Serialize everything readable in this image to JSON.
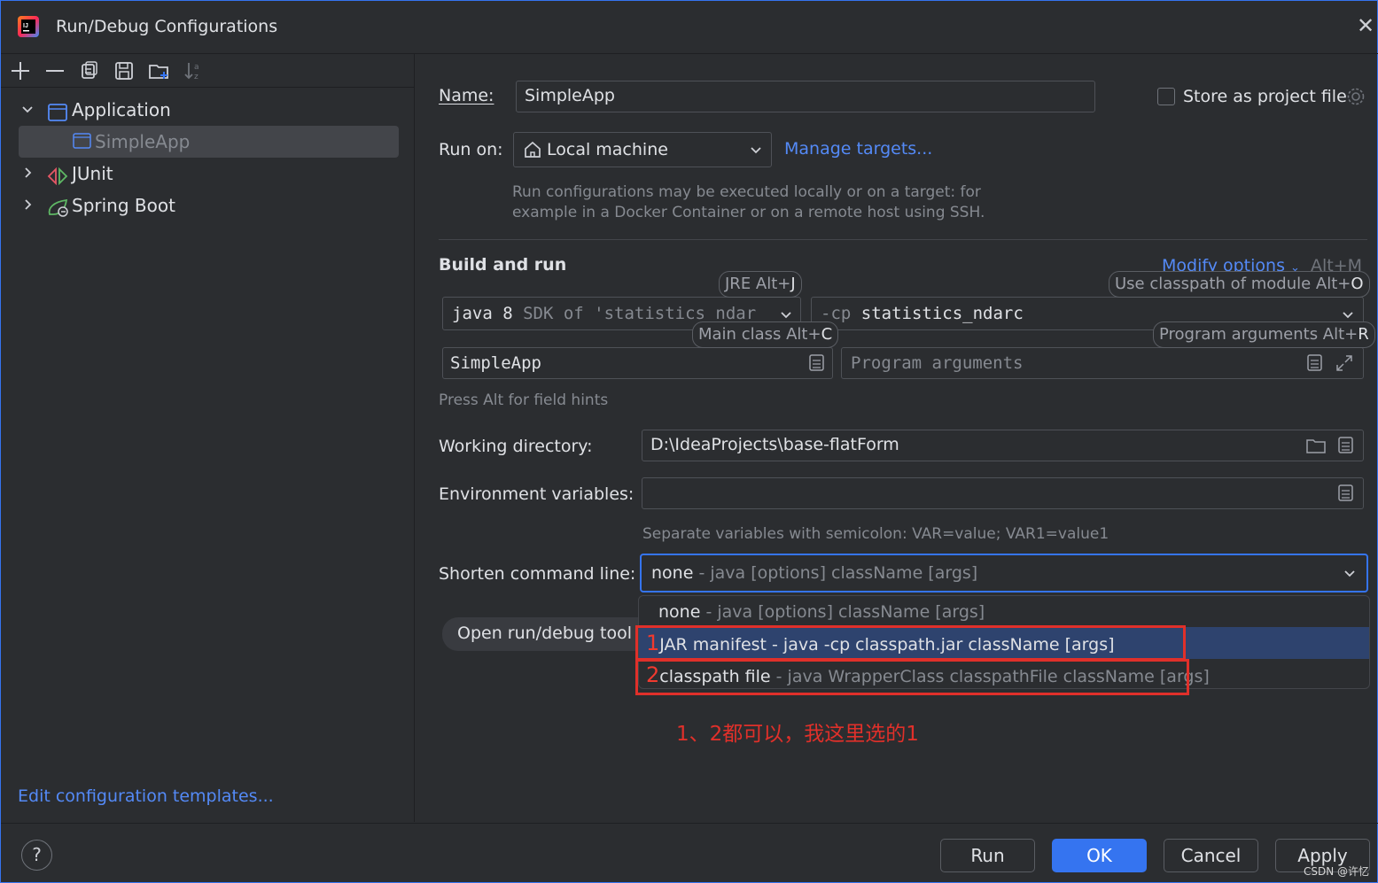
{
  "window": {
    "title": "Run/Debug Configurations"
  },
  "toolbar_icons": [
    "add-icon",
    "remove-icon",
    "copy-icon",
    "save-icon",
    "new-folder-icon",
    "sort-icon"
  ],
  "tree": {
    "application": "Application",
    "simpleapp": "SimpleApp",
    "junit": "JUnit",
    "springboot": "Spring Boot"
  },
  "edit_templates": "Edit configuration templates...",
  "form": {
    "name_label": "Name:",
    "name_value": "SimpleApp",
    "store_label": "Store as project file",
    "runon_label": "Run on:",
    "runon_value": "Local machine",
    "manage_targets": "Manage targets...",
    "runon_hint1": "Run configurations may be executed locally or on a target: for",
    "runon_hint2": "example in a Docker Container or on a remote host using SSH.",
    "build_run": "Build and run",
    "modify_options": "Modify options",
    "modify_shortcut": "Alt+M",
    "jre_hint_text": "JRE Alt+",
    "jre_hint_key": "J",
    "classpath_hint_text": "Use classpath of module Alt+",
    "classpath_hint_key": "O",
    "java_main": "java 8",
    "java_sdk": "SDK of 'statistics_ndar",
    "cp_prefix": "-cp",
    "cp_value": "statistics_ndarc",
    "mainclass_hint_text": "Main class Alt+",
    "mainclass_hint_key": "C",
    "progargs_hint_text": "Program arguments Alt+",
    "progargs_hint_key": "R",
    "mainclass_value": "SimpleApp",
    "progargs_placeholder": "Program arguments",
    "alt_hint": "Press Alt for field hints",
    "workdir_label": "Working directory:",
    "workdir_value": "D:\\IdeaProjects\\base-flatForm",
    "env_label": "Environment variables:",
    "env_value": "",
    "env_hint": "Separate variables with semicolon: VAR=value; VAR1=value1",
    "shorten_label": "Shorten command line:",
    "shorten_value": "none",
    "shorten_value_desc": " - java [options] className [args]",
    "open_tool": "Open run/debug tool w"
  },
  "dropdown": {
    "options": [
      {
        "main": "none",
        "desc": " - java [options] className [args]"
      },
      {
        "num": "1",
        "main": "JAR manifest - java -cp classpath.jar className [args]",
        "desc": ""
      },
      {
        "num": "2",
        "main": "classpath file",
        "desc": " - java WrapperClass classpathFile className [args]"
      }
    ]
  },
  "annotation": "1、2都可以，我这里选的1",
  "buttons": {
    "help": "?",
    "run": "Run",
    "ok": "OK",
    "cancel": "Cancel",
    "apply": "Apply"
  },
  "watermark": "CSDN @许忆",
  "colors": {
    "accent": "#3574f0",
    "link": "#548af7",
    "annotation": "#e0302a",
    "background": "#2b2d30"
  }
}
